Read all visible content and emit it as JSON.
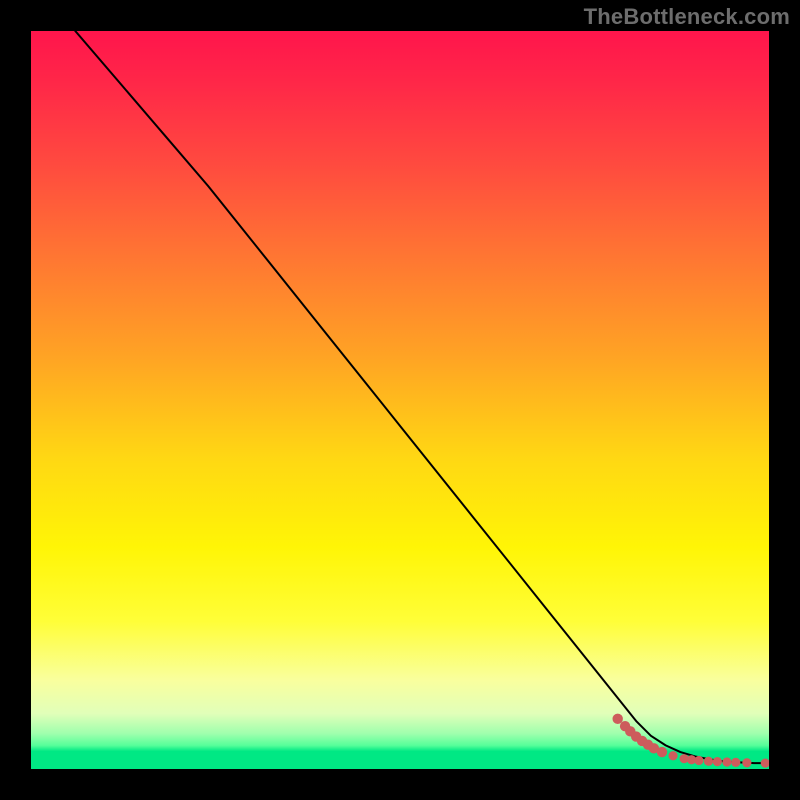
{
  "attribution": "TheBottleneck.com",
  "colors": {
    "background": "#000000",
    "curve": "#000000",
    "dots": "#cd5c5c",
    "gradient_top": "#ff154c",
    "gradient_bottom": "#00e884"
  },
  "chart_data": {
    "type": "line",
    "title": "",
    "xlabel": "",
    "ylabel": "",
    "xlim": [
      0,
      100
    ],
    "ylim": [
      0,
      100
    ],
    "axes_visible": false,
    "grid": false,
    "series": [
      {
        "name": "bottleneck-curve",
        "x": [
          6,
          12,
          18,
          24,
          28,
          32,
          40,
          50,
          60,
          70,
          78,
          82,
          84,
          86,
          88,
          90,
          92,
          94,
          96,
          98,
          100
        ],
        "y": [
          100,
          93,
          86,
          79,
          74,
          69,
          59,
          46.5,
          34,
          21.5,
          11.5,
          6.5,
          4.5,
          3.2,
          2.3,
          1.7,
          1.3,
          1.0,
          0.9,
          0.8,
          0.8
        ]
      }
    ],
    "scatter": {
      "name": "sample-points",
      "approximate": true,
      "points": [
        {
          "x": 79.5,
          "y": 6.8
        },
        {
          "x": 80.5,
          "y": 5.8
        },
        {
          "x": 81.2,
          "y": 5.1
        },
        {
          "x": 82.0,
          "y": 4.4
        },
        {
          "x": 82.8,
          "y": 3.8
        },
        {
          "x": 83.6,
          "y": 3.3
        },
        {
          "x": 84.4,
          "y": 2.8
        },
        {
          "x": 85.5,
          "y": 2.3
        },
        {
          "x": 87.0,
          "y": 1.8
        },
        {
          "x": 88.5,
          "y": 1.4
        },
        {
          "x": 89.5,
          "y": 1.25
        },
        {
          "x": 90.5,
          "y": 1.15
        },
        {
          "x": 91.8,
          "y": 1.05
        },
        {
          "x": 93.0,
          "y": 1.0
        },
        {
          "x": 94.3,
          "y": 0.95
        },
        {
          "x": 95.5,
          "y": 0.9
        },
        {
          "x": 97.0,
          "y": 0.85
        },
        {
          "x": 99.5,
          "y": 0.8
        }
      ]
    },
    "note": "Axis values are in percent of the plot width/height; no numeric axes are shown in the original image, so values are estimated from pixel positions."
  }
}
